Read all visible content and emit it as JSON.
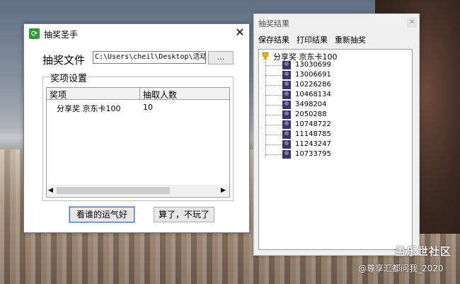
{
  "lottery_window": {
    "title": "抽奖圣手",
    "file_label": "抽奖文件",
    "file_path": "C:\\Users\\cheil\\Desktop\\活动抽",
    "browse_label": "...",
    "group_title": "奖项设置",
    "columns": [
      "奖项",
      "抽取人数"
    ],
    "rows": [
      {
        "prize": "分享奖 京东卡100",
        "count": "10"
      }
    ],
    "draw_button": "看谁的运气好",
    "quit_button": "算了，不玩了"
  },
  "result_window": {
    "title": "抽奖结果",
    "menu": [
      "保存结果",
      "打印结果",
      "重新抽奖"
    ],
    "root": "分享奖 京东卡100",
    "winners": [
      "13030699",
      "13006691",
      "10226286",
      "10468134",
      "3498204",
      "2050288",
      "10748722",
      "11148785",
      "11243247",
      "10733795"
    ]
  },
  "watermark": {
    "site": "盖乐世社区",
    "user": "@尊享汇都问我_2020"
  },
  "colors": {
    "accent": "#3c7fd8",
    "app_icon": "#2f9a3a"
  }
}
